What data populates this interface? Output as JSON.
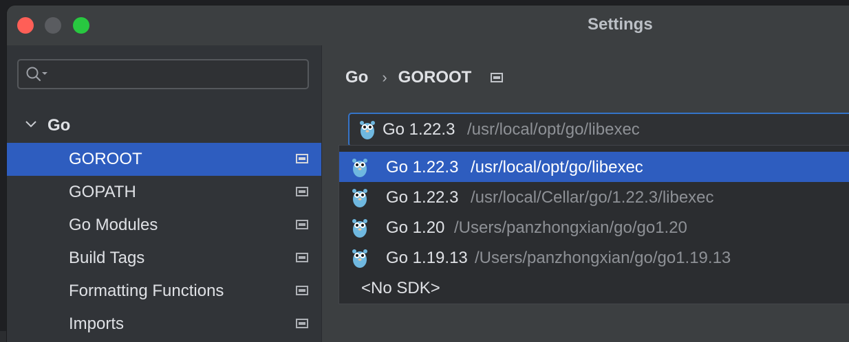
{
  "colors": {
    "accent": "#2e5dbf",
    "focus_border": "#3574c9",
    "close": "#ff5f57",
    "zoom": "#28c840"
  },
  "window": {
    "title": "Settings"
  },
  "sidebar": {
    "search": {
      "value": "",
      "icon": "search-icon"
    },
    "root": {
      "label": "Go",
      "expanded": true
    },
    "items": [
      {
        "label": "GOROOT",
        "selected": true
      },
      {
        "label": "GOPATH"
      },
      {
        "label": "Go Modules"
      },
      {
        "label": "Build Tags"
      },
      {
        "label": "Formatting Functions"
      },
      {
        "label": "Imports"
      }
    ]
  },
  "breadcrumb": {
    "parent": "Go",
    "current": "GOROOT"
  },
  "sdk": {
    "selected_name": "Go 1.22.3",
    "selected_path": "/usr/local/opt/go/libexec",
    "options": [
      {
        "name": "Go 1.22.3",
        "path": "/usr/local/opt/go/libexec",
        "selected": true
      },
      {
        "name": "Go 1.22.3",
        "path": "/usr/local/Cellar/go/1.22.3/libexec"
      },
      {
        "name": "Go 1.20",
        "path": "/Users/panzhongxian/go/go1.20"
      },
      {
        "name": "Go 1.19.13",
        "path": "/Users/panzhongxian/go/go1.19.13"
      },
      {
        "name": "<No SDK>",
        "path": ""
      }
    ]
  }
}
